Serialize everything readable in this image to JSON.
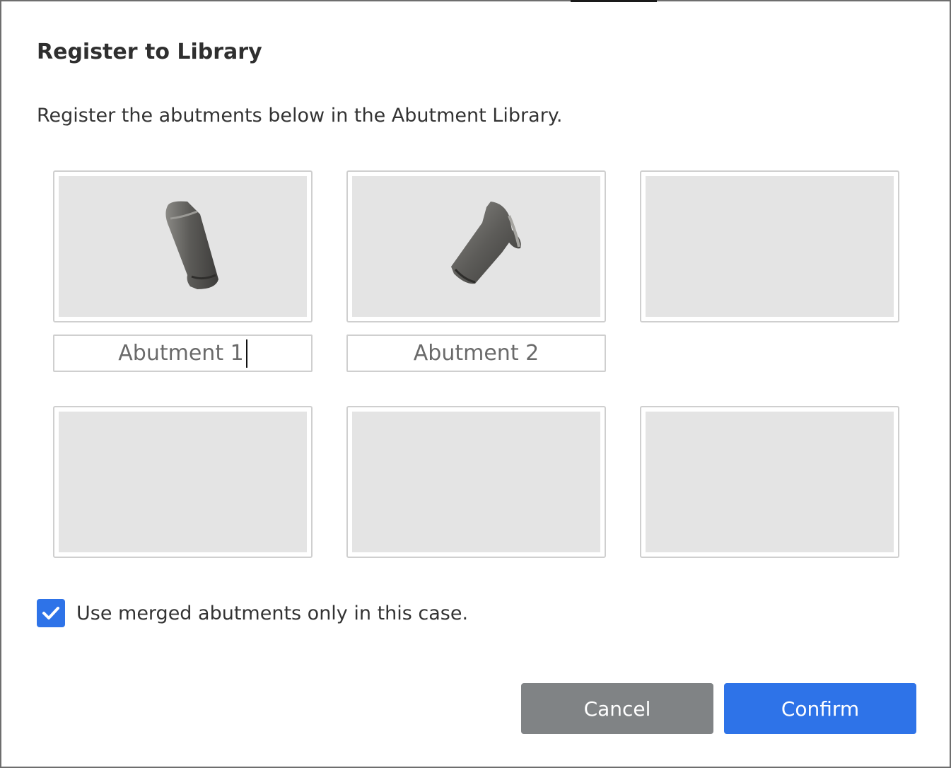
{
  "dialog": {
    "title": "Register to Library",
    "description": "Register the abutments below in the Abutment Library."
  },
  "abutments": [
    {
      "name": "Abutment 1",
      "has_model": true,
      "editing": true
    },
    {
      "name": "Abutment 2",
      "has_model": true,
      "editing": false
    },
    {
      "name": "",
      "has_model": false
    },
    {
      "name": "",
      "has_model": false
    },
    {
      "name": "",
      "has_model": false
    },
    {
      "name": "",
      "has_model": false
    }
  ],
  "option": {
    "label": "Use merged abutments only in this case.",
    "checked": true
  },
  "buttons": {
    "cancel": "Cancel",
    "confirm": "Confirm"
  },
  "colors": {
    "accent": "#2e73e8",
    "cancel_bg": "#808385",
    "slot_bg": "#e4e4e4",
    "model_gray": "#6b6a66"
  },
  "icons": {
    "checkbox": "check-icon"
  }
}
